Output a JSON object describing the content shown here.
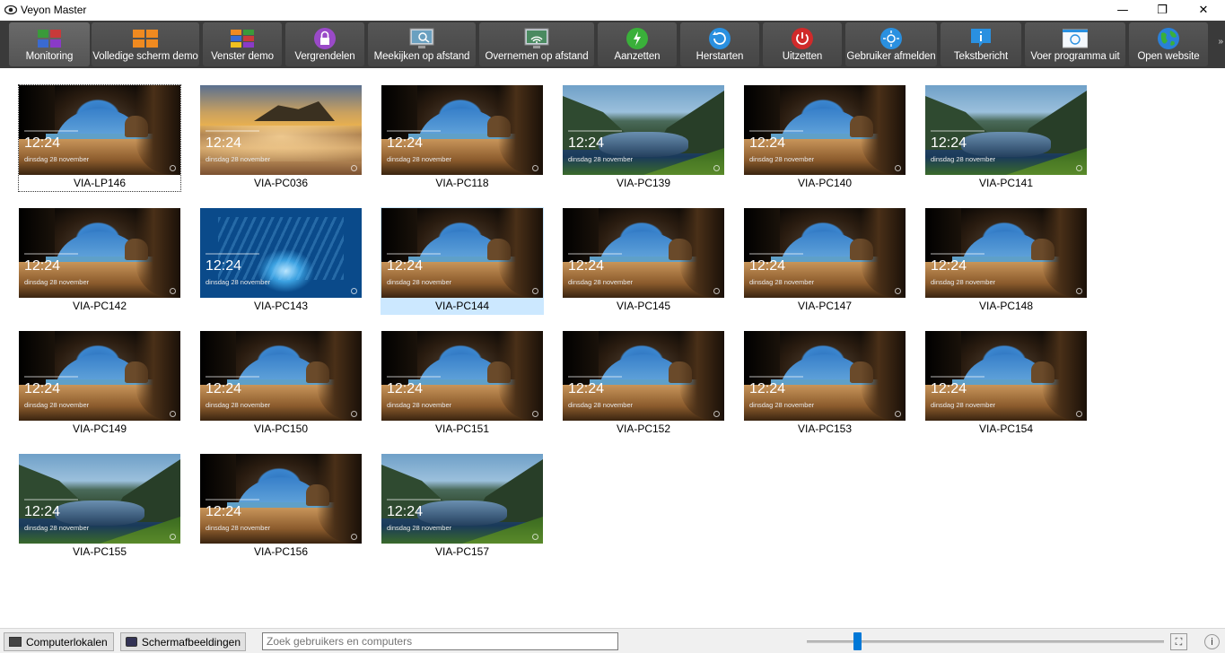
{
  "window": {
    "title": "Veyon Master",
    "minimize_glyph": "—",
    "maximize_glyph": "❐",
    "close_glyph": "✕"
  },
  "toolbar": {
    "buttons": [
      {
        "label": "Monitoring",
        "icon": "monitoring-grid-icon"
      },
      {
        "label": "Volledige scherm demo",
        "icon": "fullscreen-demo-icon"
      },
      {
        "label": "Venster demo",
        "icon": "window-demo-icon"
      },
      {
        "label": "Vergrendelen",
        "icon": "lock-icon"
      },
      {
        "label": "Meekijken op afstand",
        "icon": "remote-view-icon"
      },
      {
        "label": "Overnemen op afstand",
        "icon": "remote-control-icon"
      },
      {
        "label": "Aanzetten",
        "icon": "power-on-icon"
      },
      {
        "label": "Herstarten",
        "icon": "reboot-icon"
      },
      {
        "label": "Uitzetten",
        "icon": "power-off-icon"
      },
      {
        "label": "Gebruiker afmelden",
        "icon": "logout-user-icon"
      },
      {
        "label": "Tekstbericht",
        "icon": "text-message-icon"
      },
      {
        "label": "Voer programma uit",
        "icon": "run-program-icon"
      },
      {
        "label": "Open website",
        "icon": "globe-icon"
      }
    ],
    "overflow_glyph": "»"
  },
  "computers": [
    {
      "name": "VIA-LP146",
      "wallpaper": "cave",
      "focused": true
    },
    {
      "name": "VIA-PC036",
      "wallpaper": "sunset"
    },
    {
      "name": "VIA-PC118",
      "wallpaper": "cave"
    },
    {
      "name": "VIA-PC139",
      "wallpaper": "lake"
    },
    {
      "name": "VIA-PC140",
      "wallpaper": "cave"
    },
    {
      "name": "VIA-PC141",
      "wallpaper": "lake"
    },
    {
      "name": "VIA-PC142",
      "wallpaper": "cave"
    },
    {
      "name": "VIA-PC143",
      "wallpaper": "ice"
    },
    {
      "name": "VIA-PC144",
      "wallpaper": "cave",
      "selected": true
    },
    {
      "name": "VIA-PC145",
      "wallpaper": "cave"
    },
    {
      "name": "VIA-PC147",
      "wallpaper": "cave"
    },
    {
      "name": "VIA-PC148",
      "wallpaper": "cave"
    },
    {
      "name": "VIA-PC149",
      "wallpaper": "cave"
    },
    {
      "name": "VIA-PC150",
      "wallpaper": "cave"
    },
    {
      "name": "VIA-PC151",
      "wallpaper": "cave"
    },
    {
      "name": "VIA-PC152",
      "wallpaper": "cave"
    },
    {
      "name": "VIA-PC153",
      "wallpaper": "cave"
    },
    {
      "name": "VIA-PC154",
      "wallpaper": "cave"
    },
    {
      "name": "VIA-PC155",
      "wallpaper": "lake"
    },
    {
      "name": "VIA-PC156",
      "wallpaper": "cave"
    },
    {
      "name": "VIA-PC157",
      "wallpaper": "lake"
    }
  ],
  "lockscreen": {
    "time": "12:24",
    "date": "dinsdag 28 november"
  },
  "statusbar": {
    "computer_rooms_label": "Computerlokalen",
    "screenshots_label": "Schermafbeeldingen",
    "search_placeholder": "Zoek gebruikers en computers",
    "zoom_slider_fraction": 0.14,
    "autofit_icon": "autofit-icon",
    "about_icon": "info-icon"
  },
  "colors": {
    "toolbar_bg": "#3a3a3a",
    "selection": "#cce8ff",
    "slider_accent": "#0078d7"
  }
}
